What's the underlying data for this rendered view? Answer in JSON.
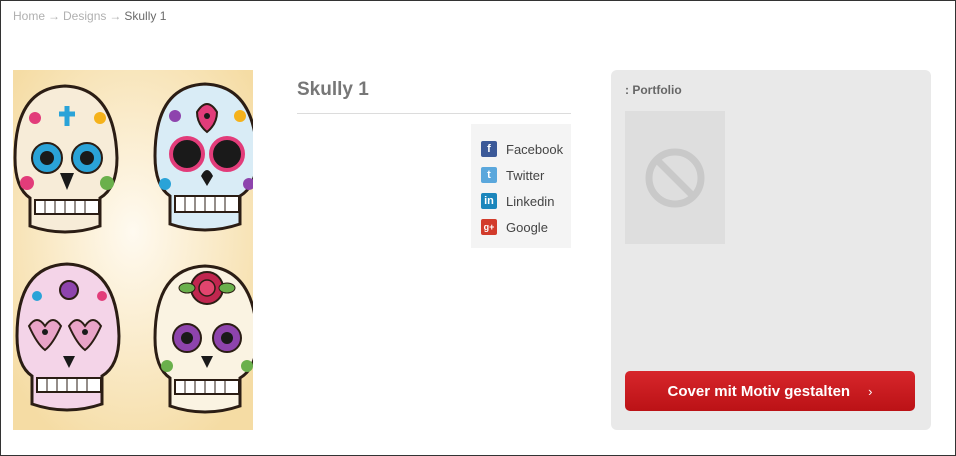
{
  "breadcrumb": {
    "items": [
      "Home",
      "Designs"
    ],
    "separator": "→",
    "current": "Skully 1"
  },
  "product": {
    "title": "Skully 1",
    "artwork_icon": "sugar-skulls-artwork"
  },
  "share": {
    "items": [
      {
        "label": "Facebook",
        "icon": "facebook-icon",
        "glyph": "f",
        "color": "#3b5998"
      },
      {
        "label": "Twitter",
        "icon": "twitter-icon",
        "glyph": "t",
        "color": "#5aa7dc"
      },
      {
        "label": "Linkedin",
        "icon": "linkedin-icon",
        "glyph": "in",
        "color": "#1b86bc"
      },
      {
        "label": "Google",
        "icon": "google-plus-icon",
        "glyph": "g+",
        "color": "#d23b2b"
      }
    ]
  },
  "panel": {
    "label": ": Portfolio",
    "placeholder_icon": "no-image-icon",
    "cta_label": "Cover mit Motiv gestalten",
    "cta_chevron": "›",
    "cta_color": "#c8171c"
  }
}
